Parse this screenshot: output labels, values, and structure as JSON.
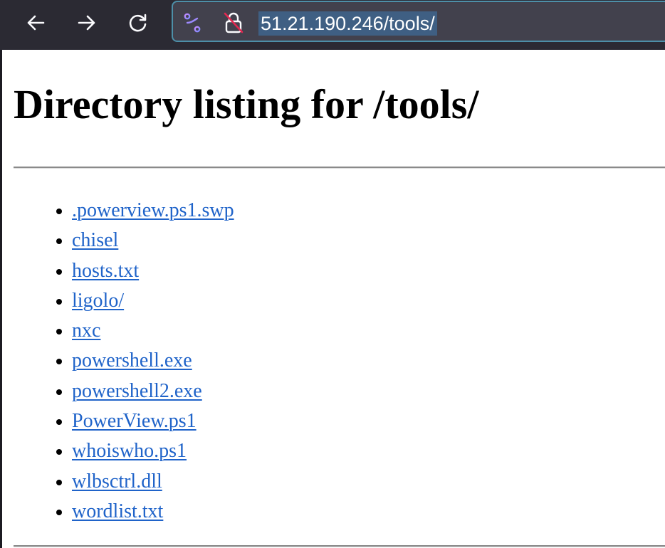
{
  "browser": {
    "url": "51.21.190.246/tools/",
    "icons": {
      "back": "arrow-left-icon",
      "forward": "arrow-right-icon",
      "reload": "reload-icon",
      "tracking": "tracking-protection-icon",
      "lock": "insecure-lock-icon"
    },
    "colors": {
      "toolbar": "#2b2a33",
      "urlbar": "#42414d",
      "urlbar_focus_border": "#4d8fa8",
      "url_selection": "#3f5f83",
      "link": "#1f63c9"
    }
  },
  "page": {
    "title": "Directory listing for /tools/",
    "files": [
      ".powerview.ps1.swp",
      "chisel",
      "hosts.txt",
      "ligolo/",
      "nxc",
      "powershell.exe",
      "powershell2.exe",
      "PowerView.ps1",
      "whoiswho.ps1",
      "wlbsctrl.dll",
      "wordlist.txt"
    ]
  }
}
